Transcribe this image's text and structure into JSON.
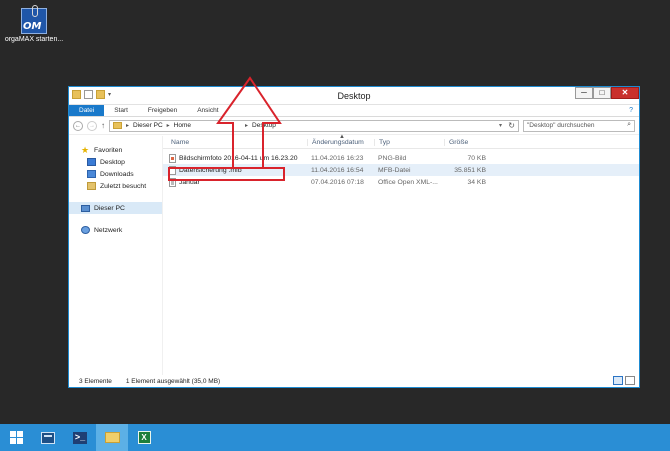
{
  "desktop": {
    "icon_label": "orgaMAX starten...",
    "icon_name": "orgamax-icon",
    "icon_text": "OM"
  },
  "window": {
    "title": "Desktop",
    "controls": {
      "minimize": "─",
      "maximize": "□",
      "close": "✕"
    },
    "ribbon_tabs": [
      "Datei",
      "Start",
      "Freigeben",
      "Ansicht"
    ],
    "help": "?"
  },
  "address": {
    "path": [
      "Dieser PC",
      "Home",
      "Desktop"
    ],
    "search_placeholder": "\"Desktop\" durchsuchen"
  },
  "nav_pane": {
    "favorites": "Favoriten",
    "favorite_items": [
      "Desktop",
      "Downloads",
      "Zuletzt besucht"
    ],
    "this_pc": "Dieser PC",
    "network": "Netzwerk"
  },
  "columns": {
    "name": "Name",
    "date": "Änderungsdatum",
    "type": "Typ",
    "size": "Größe"
  },
  "files": [
    {
      "name": "Bildschirmfoto 2016-04-11 um 16.23.20",
      "date": "11.04.2016 16:23",
      "type": "PNG-Bild",
      "size": "70 KB",
      "icon": "png-file-icon"
    },
    {
      "name": "Datensicherung .mfb",
      "date": "11.04.2016 16:54",
      "type": "MFB-Datei",
      "size": "35.851 KB",
      "icon": "file-icon"
    },
    {
      "name": "Januar",
      "date": "07.04.2016 07:18",
      "type": "Office Open XML-...",
      "size": "34 KB",
      "icon": "xml-file-icon"
    }
  ],
  "status": {
    "count": "3 Elemente",
    "selection": "1 Element ausgewählt (35,0 MB)"
  },
  "annotation_color": "#d9232c",
  "taskbar": {
    "color": "#2a8ed5",
    "items": [
      "windows-start-icon",
      "server-manager-icon",
      "powershell-icon",
      "file-explorer-icon",
      "excel-icon"
    ],
    "powershell_glyph": ">_",
    "excel_glyph": "X"
  }
}
